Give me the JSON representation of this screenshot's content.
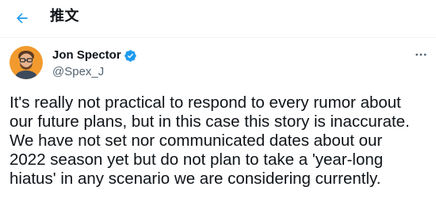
{
  "header": {
    "back_icon": "arrow-left-icon",
    "title": "推文"
  },
  "tweet": {
    "author": {
      "name": "Jon Spector",
      "handle": "@Spex_J",
      "verified": true,
      "avatar_icon": "user-avatar"
    },
    "more_icon": "more-horizontal-icon",
    "lines": [
      "It's really not practical to respond to every rumor about",
      "our future plans, but in this case this story is inaccurate.",
      "We have not set nor communicated dates about our",
      "2022 season yet but do not plan to take a 'year-long",
      "hiatus' in any scenario we are considering currently."
    ]
  },
  "colors": {
    "accent": "#1d9bf0",
    "text_primary": "#0f1419",
    "text_secondary": "#536471",
    "avatar_bg": "#f29a2e"
  }
}
